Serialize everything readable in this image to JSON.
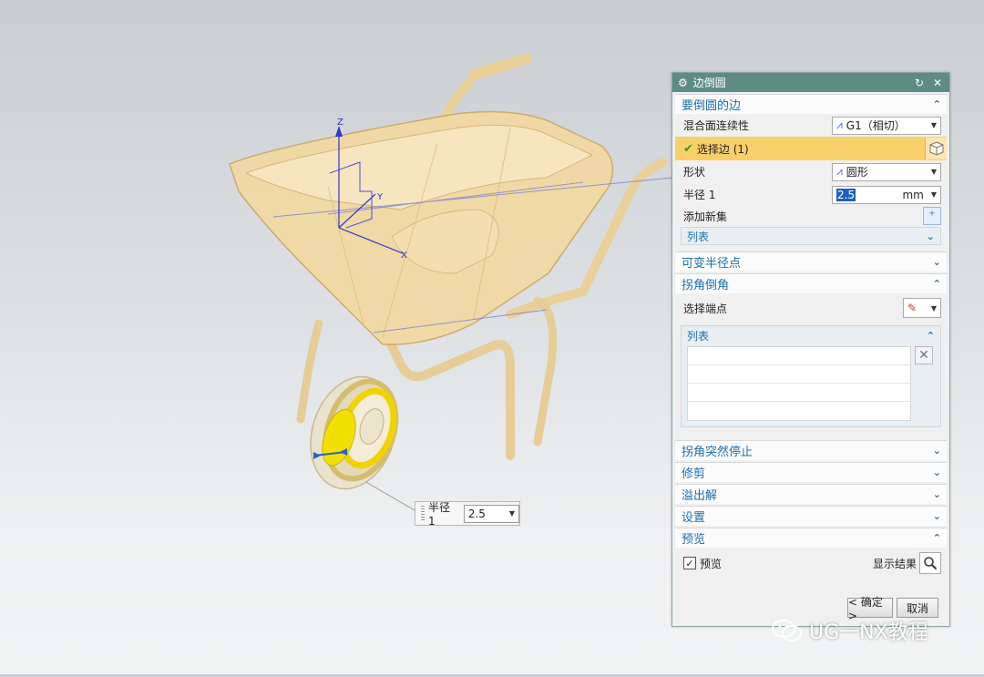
{
  "viewport": {
    "axis_labels": {
      "z": "Z",
      "y": "Y",
      "x": "X"
    },
    "floating_radius": {
      "label": "半径 1",
      "value": "2.5"
    }
  },
  "dialog": {
    "title": "边倒圆",
    "sections": {
      "edges": {
        "title": "要倒圆的边"
      },
      "variable_radius": {
        "title": "可变半径点"
      },
      "corner_setback": {
        "title": "拐角倒角"
      },
      "corner_stop": {
        "title": "拐角突然停止"
      },
      "trim": {
        "title": "修剪"
      },
      "overflow": {
        "title": "溢出解"
      },
      "settings": {
        "title": "设置"
      },
      "preview": {
        "title": "预览"
      }
    },
    "edges": {
      "continuity_label": "混合面连续性",
      "continuity_value": "G1（相切）",
      "select_edge_label": "选择边 (1)",
      "shape_label": "形状",
      "shape_value": "圆形",
      "radius_label": "半径 1",
      "radius_value": "2.5",
      "radius_unit": "mm",
      "add_new_set_label": "添加新集",
      "list_label": "列表"
    },
    "corner_setback": {
      "select_endpoint_label": "选择端点",
      "list_label": "列表"
    },
    "preview": {
      "checkbox_label": "预览",
      "checked": true,
      "show_result_label": "显示结果"
    },
    "buttons": {
      "ok": "< 确定 >",
      "cancel": "取消"
    }
  },
  "watermark": {
    "text": "UG一NX教程"
  },
  "colors": {
    "title_bar": "#5f8c82",
    "section_text": "#1e6fae",
    "selected_row": "#f9cf6a",
    "model": "#f1d9a3"
  }
}
